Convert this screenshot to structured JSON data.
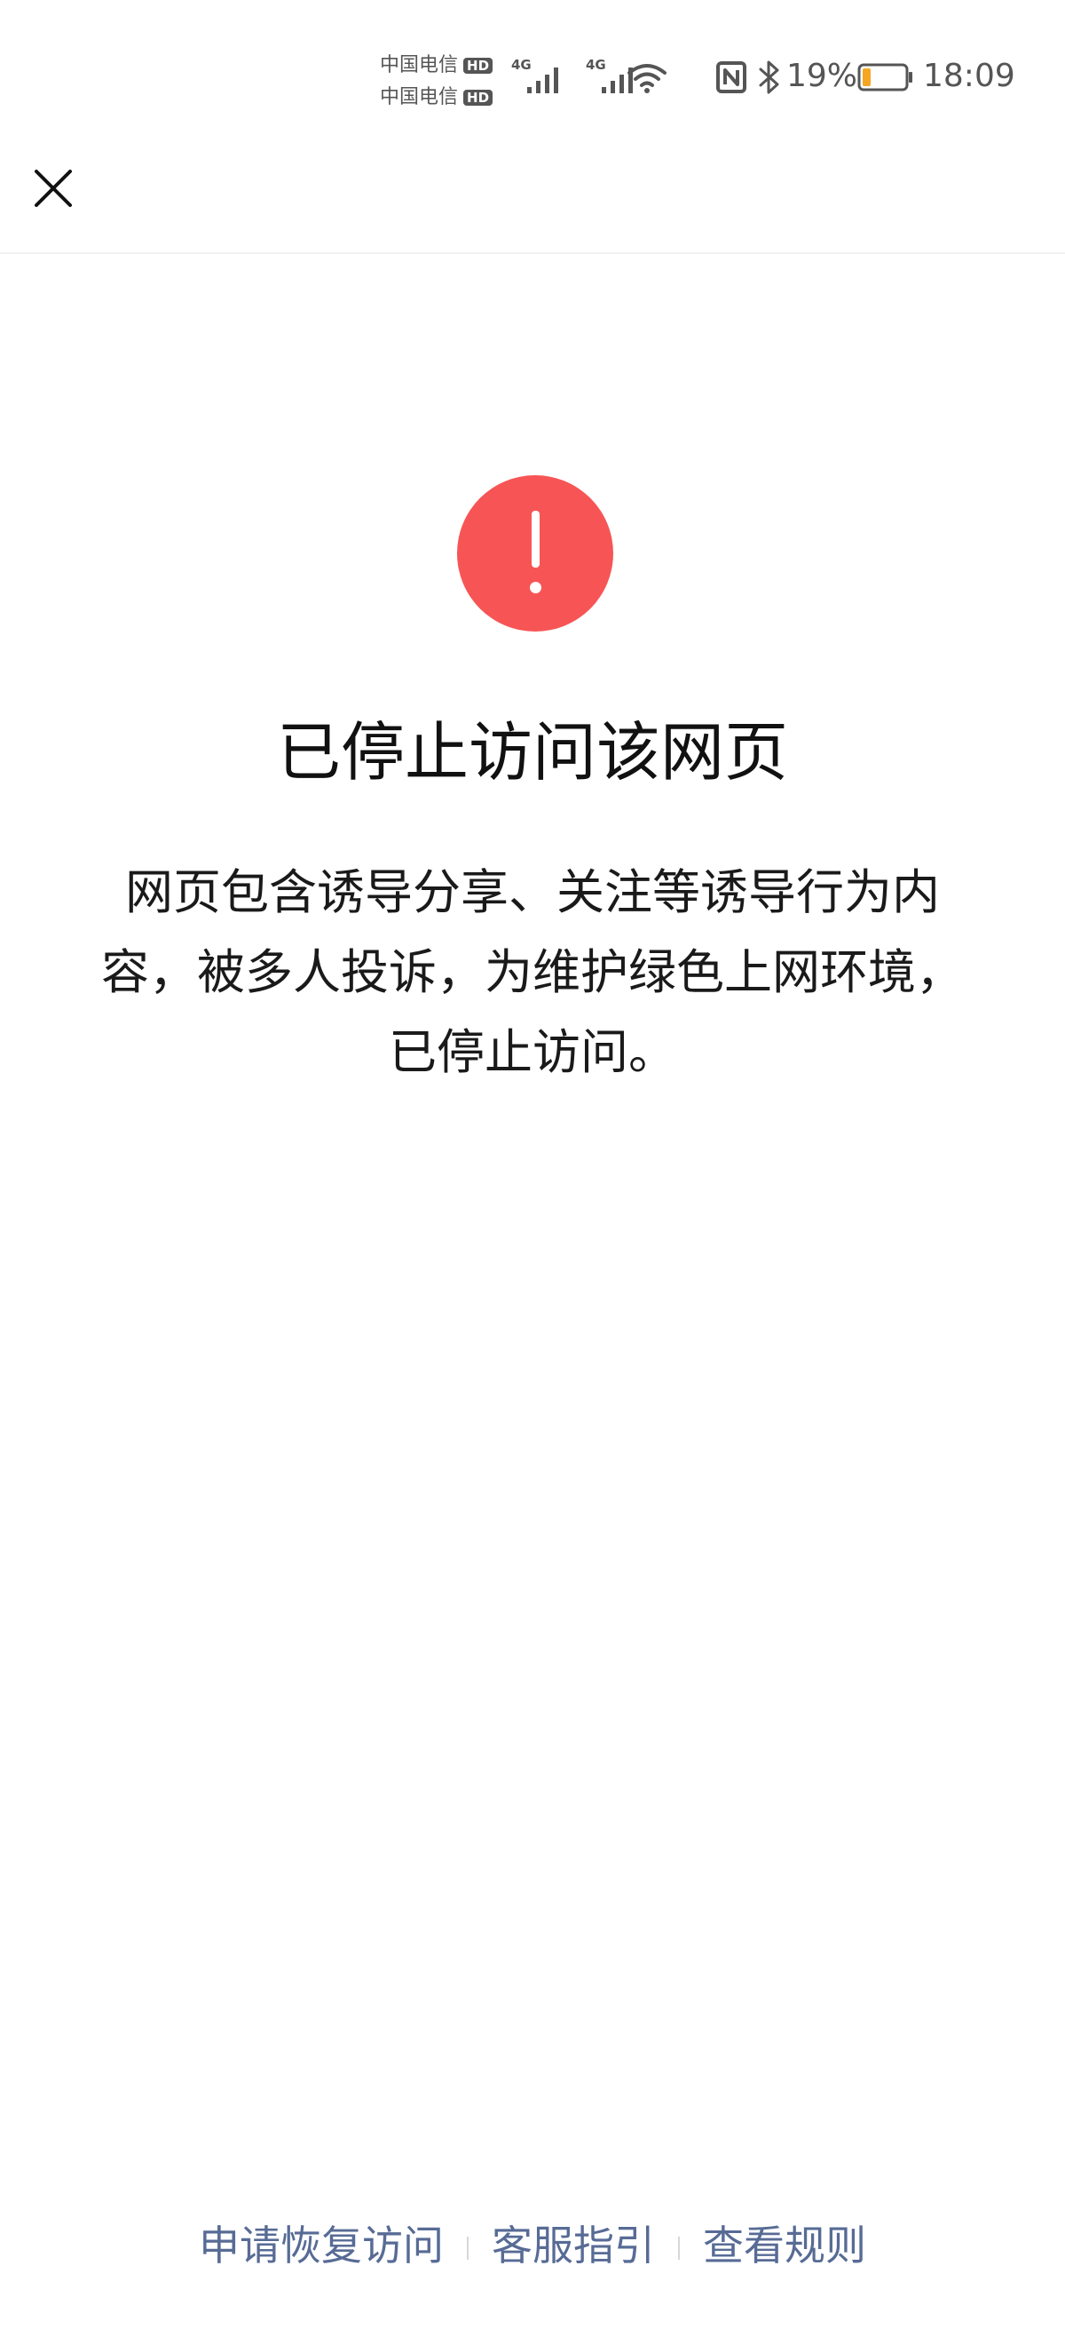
{
  "status_bar": {
    "carriers": [
      {
        "name": "中国电信",
        "badge": "HD"
      },
      {
        "name": "中国电信",
        "badge": "HD"
      }
    ],
    "signals": [
      {
        "network": "4G",
        "icon": "signal-icon"
      },
      {
        "network": "4G",
        "icon": "signal-icon"
      }
    ],
    "wifi_icon": "wifi-icon",
    "nfc_icon": "nfc-icon",
    "bluetooth_icon": "bluetooth-icon",
    "battery_percent": "19%",
    "battery_level": 0.19,
    "battery_color": "#f5a623",
    "time": "18:09"
  },
  "nav": {
    "close_icon": "close-icon"
  },
  "main": {
    "icon": "exclamation-circle-icon",
    "icon_color": "#f75555",
    "title": "已停止访问该网页",
    "message": "网页包含诱导分享、关注等诱导行为内容，被多人投诉，为维护绿色上网环境，已停止访问。"
  },
  "footer": {
    "link_color": "#576b95",
    "links": [
      {
        "label": "申请恢复访问"
      },
      {
        "label": "客服指引"
      },
      {
        "label": "查看规则"
      }
    ]
  }
}
